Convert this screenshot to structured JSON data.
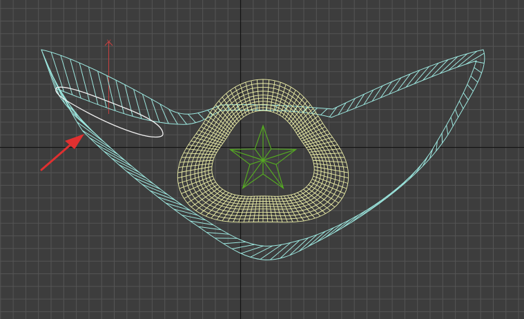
{
  "viewport": {
    "view": "orthographic",
    "background_color": "#3d3d3d",
    "grid_color": "#555555",
    "home_axis_color": "#111111"
  },
  "gizmo": {
    "axis_label": "Y",
    "color": "#c84040"
  },
  "objects": [
    {
      "name": "wing-shield-mesh",
      "color": "#9de8e0",
      "selected": false
    },
    {
      "name": "ring-emblem-mesh",
      "color": "#eef0a8",
      "selected": true
    },
    {
      "name": "star-mesh",
      "color": "#55aa22",
      "selected": false
    },
    {
      "name": "spline-outline",
      "color": "#f2f2f2",
      "selected": false
    }
  ],
  "annotation": {
    "kind": "arrow",
    "color": "#e03030",
    "points_to": "spline-outline"
  }
}
